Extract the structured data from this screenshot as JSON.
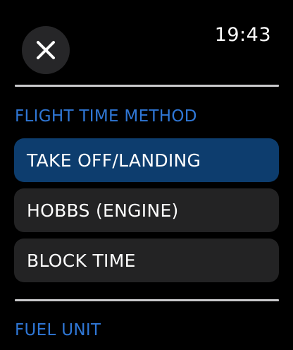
{
  "header": {
    "close_icon": "close-icon",
    "time": "19:43"
  },
  "flight_time_method": {
    "title": "FLIGHT TIME METHOD",
    "options": [
      {
        "label": "TAKE OFF/LANDING",
        "selected": true
      },
      {
        "label": "HOBBS (ENGINE)",
        "selected": false
      },
      {
        "label": "BLOCK TIME",
        "selected": false
      }
    ]
  },
  "fuel_unit": {
    "title": "FUEL UNIT"
  },
  "colors": {
    "background": "#000000",
    "accent": "#2f77d6",
    "selected_option": "#0d3d6e",
    "option": "#232324",
    "divider": "#c9c9cb"
  }
}
